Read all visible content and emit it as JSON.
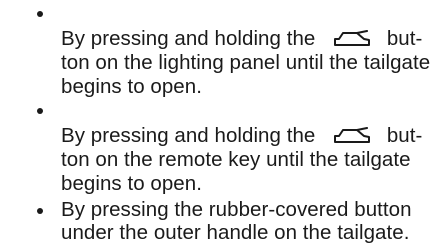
{
  "items": [
    {
      "before_icon": "By pressing and holding the",
      "icon": "tailgate-car-icon",
      "after_icon": "but-",
      "lines": [
        "ton on the lighting panel until the tailgate",
        "begins to open."
      ]
    },
    {
      "before_icon": "By pressing and holding the",
      "icon": "tailgate-car-icon",
      "after_icon": "but-",
      "lines": [
        "ton on the remote key until the tailgate",
        "begins to open."
      ]
    },
    {
      "lines": [
        "By pressing the rubber-covered button",
        "under the outer handle on the tailgate."
      ]
    }
  ]
}
